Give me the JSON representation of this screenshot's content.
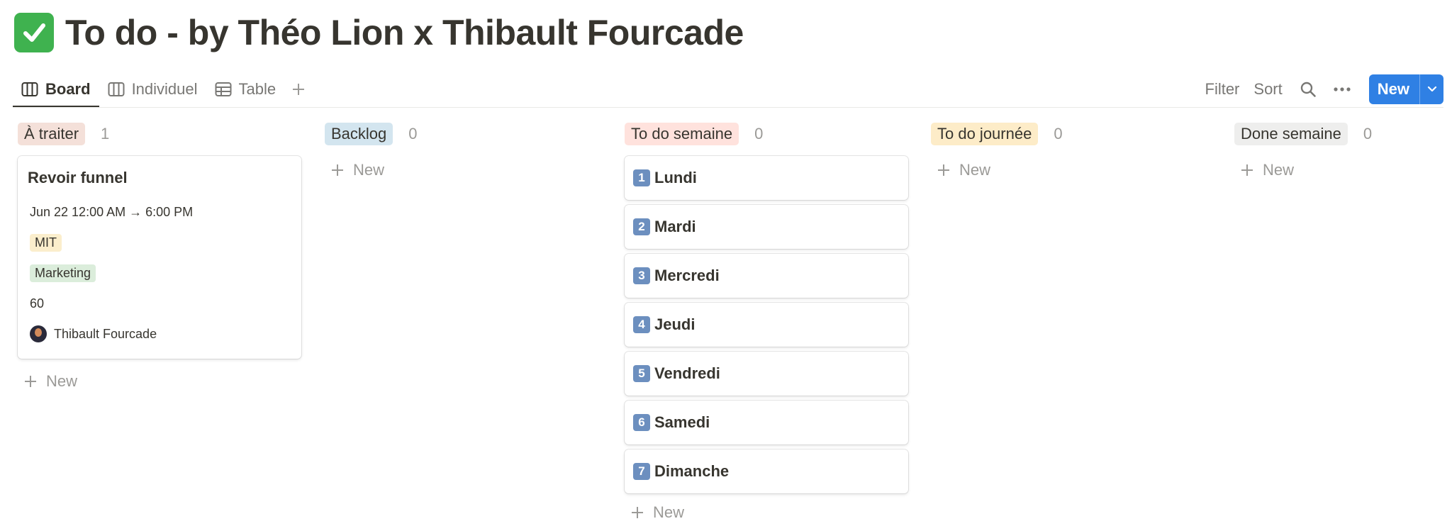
{
  "page": {
    "title": "To do - by Théo Lion x Thibault Fourcade",
    "title_icon": "check-mark-button-icon"
  },
  "views": [
    {
      "label": "Board",
      "icon": "board-icon",
      "active": true
    },
    {
      "label": "Individuel",
      "icon": "board-icon",
      "active": false
    },
    {
      "label": "Table",
      "icon": "table-icon",
      "active": false
    }
  ],
  "actions": {
    "filter": "Filter",
    "sort": "Sort",
    "new": "New"
  },
  "columns": [
    {
      "name": "À traiter",
      "count": "1",
      "color": "#f4e0d9",
      "text_color": "#37352f",
      "cards": [
        {
          "title": "Revoir funnel",
          "date": "Jun 22 12:00 AM → 6:00 PM",
          "tag1": "MIT",
          "tag1_color": "#fbeecc",
          "tag2": "Marketing",
          "tag2_color": "#dbeddb",
          "number": "60",
          "person": "Thibault Fourcade"
        }
      ],
      "new_label": "New"
    },
    {
      "name": "Backlog",
      "count": "0",
      "color": "#d3e5ef",
      "text_color": "#37352f",
      "cards": [],
      "new_label": "New"
    },
    {
      "name": "To do semaine",
      "count": "0",
      "color": "#ffe2dd",
      "text_color": "#37352f",
      "cards": [
        {
          "emoji": "1",
          "title": "Lundi"
        },
        {
          "emoji": "2",
          "title": "Mardi"
        },
        {
          "emoji": "3",
          "title": "Mercredi"
        },
        {
          "emoji": "4",
          "title": "Jeudi"
        },
        {
          "emoji": "5",
          "title": "Vendredi"
        },
        {
          "emoji": "6",
          "title": "Samedi"
        },
        {
          "emoji": "7",
          "title": "Dimanche"
        }
      ],
      "new_label": "New"
    },
    {
      "name": "To do journée",
      "count": "0",
      "color": "#fdecc8",
      "text_color": "#37352f",
      "cards": [],
      "new_label": "New"
    },
    {
      "name": "Done semaine",
      "count": "0",
      "color": "#eeeeed",
      "text_color": "#37352f",
      "cards": [],
      "new_label": "New"
    }
  ]
}
